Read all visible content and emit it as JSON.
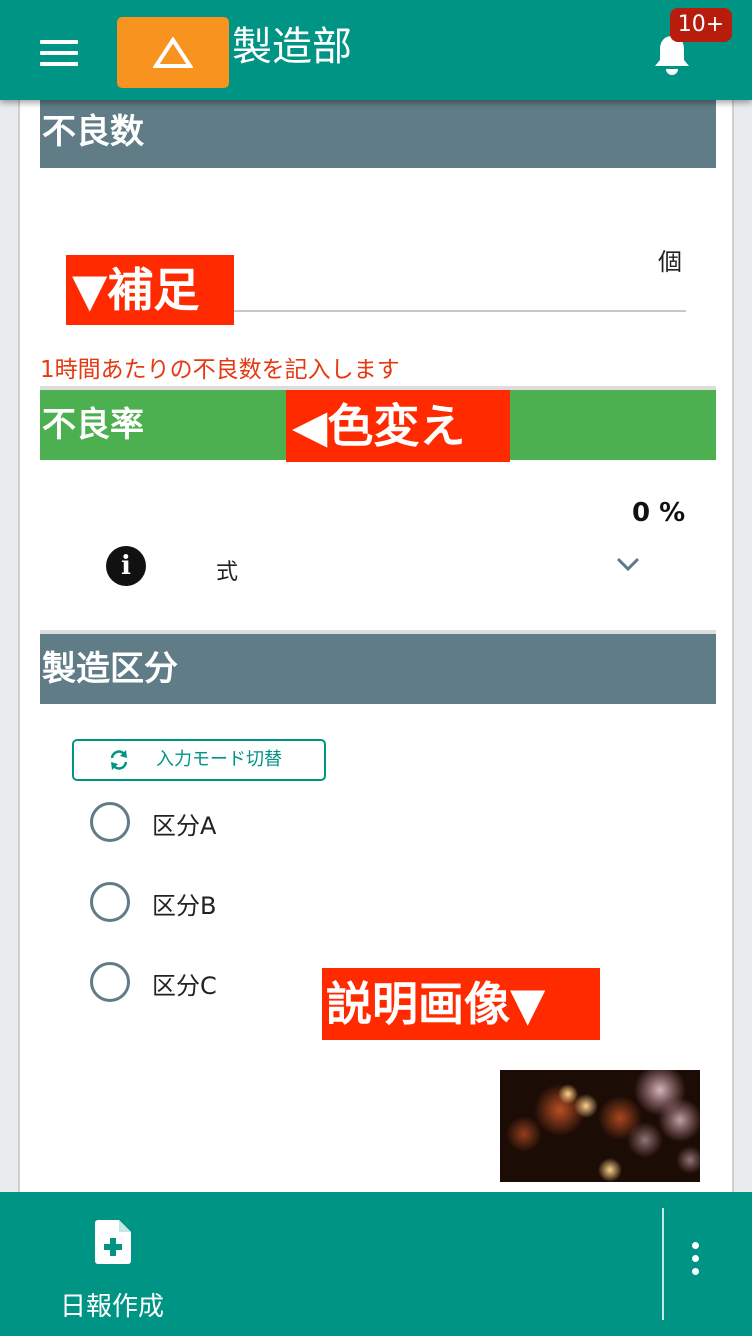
{
  "header": {
    "title": "製造部",
    "notification_badge": "10+",
    "colors": {
      "bar": "#009485",
      "logo": "#f7931e",
      "badge": "#b71c0c"
    }
  },
  "sections": {
    "defects": {
      "title": "不良数",
      "unit": "個",
      "note": "1時間あたりの不良数を記入します",
      "annotation": "▼補足"
    },
    "defect_rate": {
      "title": "不良率",
      "annotation": "◀色変え",
      "value": "0 %",
      "formula_label": "式"
    },
    "category": {
      "title": "製造区分",
      "mode_button_label": "入力モード切替",
      "options": [
        "区分A",
        "区分B",
        "区分C"
      ],
      "annotation": "説明画像▼"
    }
  },
  "footer": {
    "create_report_label": "日報作成"
  },
  "icons": [
    "hamburger-icon",
    "warning-triangle-icon",
    "bell-icon",
    "info-icon",
    "chevron-down-icon",
    "sync-icon",
    "file-add-icon",
    "more-vert-icon"
  ],
  "colors": {
    "section_header": "#607d87",
    "highlight_header": "#4caf50",
    "annotation_bg": "#ff2a00",
    "note_text": "#e53912"
  }
}
